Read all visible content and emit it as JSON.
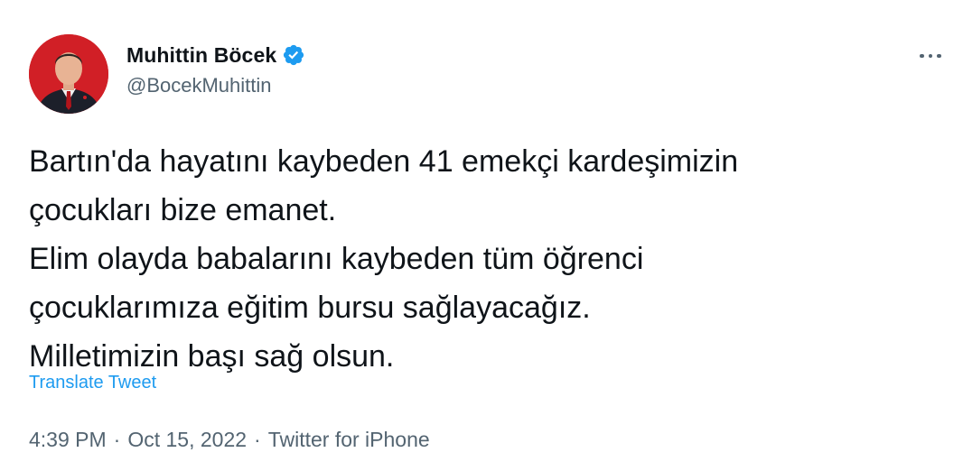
{
  "author": {
    "display_name": "Muhittin Böcek",
    "handle": "@BocekMuhittin",
    "verified": true
  },
  "tweet": {
    "text": "Bartın'da hayatını kaybeden 41 emekçi kardeşimizin\nçocukları bize emanet.\nElim olayda babalarını kaybeden tüm öğrenci\nçocuklarımıza eğitim bursu sağlayacağız.\nMilletimizin başı sağ olsun.",
    "translate_label": "Translate Tweet",
    "time": "4:39 PM",
    "separator": "·",
    "date": "Oct 15, 2022",
    "source": "Twitter for iPhone"
  },
  "icons": {
    "verified": "verified-badge-icon",
    "more": "more-options-icon"
  },
  "colors": {
    "link": "#1d9bf0",
    "secondary_text": "#536471",
    "primary_text": "#0f1419",
    "avatar_bg": "#d11f26"
  }
}
